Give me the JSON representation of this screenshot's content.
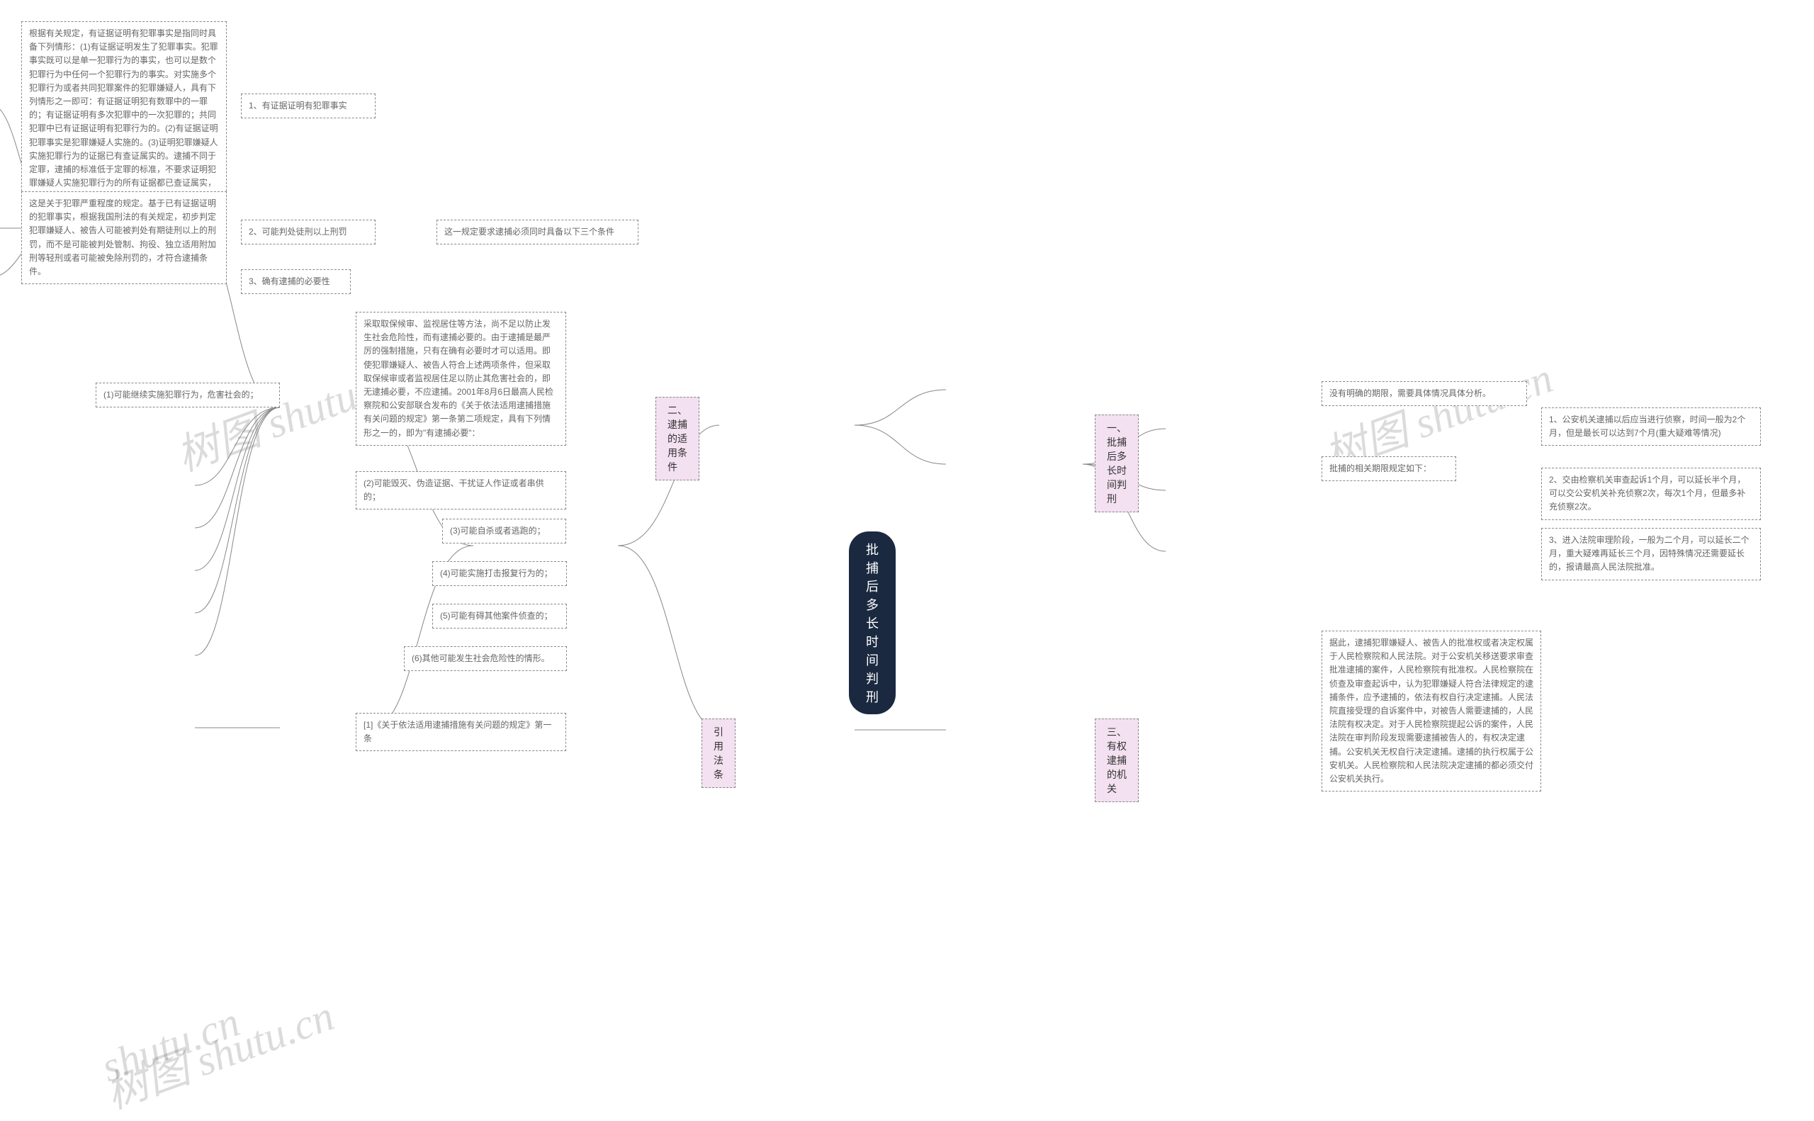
{
  "root": "批捕后多长时间判刑",
  "watermarks": [
    "树图 shutu.cn",
    "树图 shutu.cn",
    "树图 shutu.cn",
    "shutu.cn"
  ],
  "branches": {
    "b1": {
      "title": "一、批捕后多长时间判刑",
      "children": {
        "c1": "没有明确的期限，需要具体情况具体分析。",
        "c2": "批捕的相关期限规定如下：",
        "c2_children": {
          "d1": "1、公安机关逮捕以后应当进行侦察，时间一般为2个月，但是最长可以达到7个月(重大疑难等情况)",
          "d2": "2、交由检察机关审查起诉1个月，可以延长半个月，可以交公安机关补充侦察2次，每次1个月，但最多补充侦察2次。",
          "d3": "3、进入法院审理阶段，一般为二个月，可以延长二个月，重大疑难再延长三个月，因特殊情况还需要延长的，报请最高人民法院批准。"
        }
      }
    },
    "b2": {
      "title": "二、逮捕的适用条件",
      "child": "这一规定要求逮捕必须同时具备以下三个条件",
      "conds": {
        "e1": "1、有证据证明有犯罪事实",
        "e1_detail": "根据有关规定，有证据证明有犯罪事实是指同时具备下列情形：(1)有证据证明发生了犯罪事实。犯罪事实既可以是单一犯罪行为的事实，也可以是数个犯罪行为中任何一个犯罪行为的事实。对实施多个犯罪行为或者共同犯罪案件的犯罪嫌疑人，具有下列情形之一即可：有证据证明犯有数罪中的一罪的；有证据证明有多次犯罪中的一次犯罪的；共同犯罪中已有证据证明有犯罪行为的。(2)有证据证明犯罪事实是犯罪嫌疑人实施的。(3)证明犯罪嫌疑人实施犯罪行为的证据已有查证属实的。逮捕不同于定罪，逮捕的标准低于定罪的标准，不要求证明犯罪嫌疑人实施犯罪行为的所有证据都已查证属实，只要求有证据已被查证属实即可",
        "e2": "2、可能判处徒刑以上刑罚",
        "e2_detail": "这是关于犯罪严重程度的规定。基于已有证据证明的犯罪事实，根据我国刑法的有关规定，初步判定犯罪嫌疑人、被告人可能被判处有期徒刑以上的刑罚，而不是可能被判处管制、拘役、独立适用附加刑等轻刑或者可能被免除刑罚的，才符合逮捕条件。",
        "e3": "3、确有逮捕的必要性"
      },
      "necessity_intro": "采取取保候审、监视居住等方法，尚不足以防止发生社会危险性，而有逮捕必要的。由于逮捕是最严厉的强制措施，只有在确有必要时才可以适用。即使犯罪嫌疑人、被告人符合上述两项条件，但采取取保候审或者监视居住足以防止其危害社会的，即无逮捕必要，不应逮捕。2001年8月6日最高人民检察院和公安部联合发布的《关于依法适用逮捕措施有关问题的规定》第一条第二项规定，具有下列情形之一的，即为\"有逮捕必要\"：",
      "necessity_items": {
        "n1": "(1)可能继续实施犯罪行为，危害社会的；",
        "n2": "(2)可能毁灭、伪造证据、干扰证人作证或者串供的；",
        "n3": "(3)可能自杀或者逃跑的；",
        "n4": "(4)可能实施打击报复行为的；",
        "n5": "(5)可能有碍其他案件侦查的；",
        "n6": "(6)其他可能发生社会危险性的情形。"
      }
    },
    "b3": {
      "title": "三、有权逮捕的机关",
      "detail": "据此，逮捕犯罪嫌疑人、被告人的批准权或者决定权属于人民检察院和人民法院。对于公安机关移送要求审查批准逮捕的案件，人民检察院有批准权。人民检察院在侦查及审查起诉中，认为犯罪嫌疑人符合法律规定的逮捕条件，应予逮捕的，依法有权自行决定逮捕。人民法院直接受理的自诉案件中，对被告人需要逮捕的，人民法院有权决定。对于人民检察院提起公诉的案件，人民法院在审判阶段发现需要逮捕被告人的，有权决定逮捕。公安机关无权自行决定逮捕。逮捕的执行权属于公安机关。人民检察院和人民法院决定逮捕的都必须交付公安机关执行。"
    },
    "b4": {
      "title": "引用法条",
      "detail": "[1]《关于依法适用逮捕措施有关问题的规定》第一条"
    }
  }
}
